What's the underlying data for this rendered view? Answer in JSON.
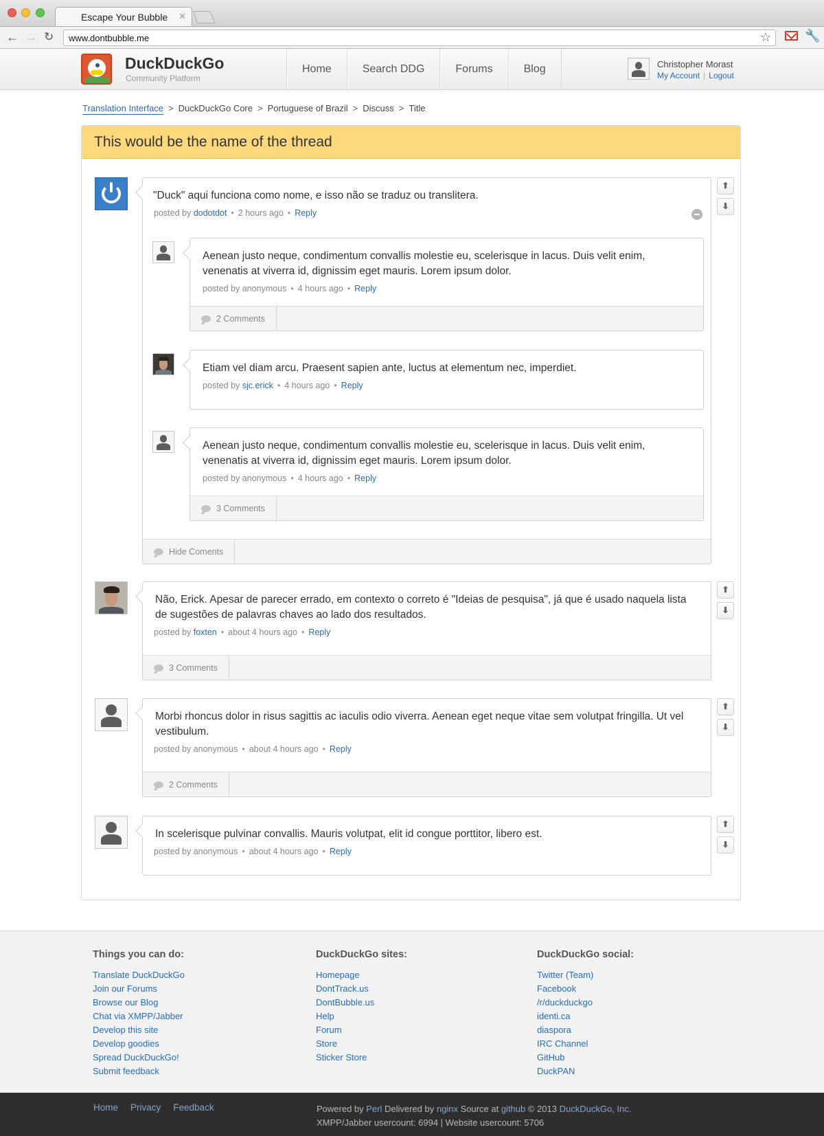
{
  "browser": {
    "tab_title": "Escape Your Bubble",
    "url": "www.dontbubble.me"
  },
  "header": {
    "brand_name": "DuckDuckGo",
    "brand_sub": "Community Platform",
    "nav": [
      "Home",
      "Search DDG",
      "Forums",
      "Blog"
    ],
    "user_name": "Christopher Morast",
    "my_account": "My Account",
    "logout": "Logout"
  },
  "breadcrumb": [
    "Translation Interface",
    "DuckDuckGo Core",
    "Portuguese of Brazil",
    "Discuss",
    "Title"
  ],
  "thread": {
    "title": "This would be the name of the thread",
    "posted_by_label": "posted by",
    "reply_label": "Reply",
    "posts": [
      {
        "text": "\"Duck\" aqui funciona como nome, e isso não se traduz ou translitera.",
        "author": "dodotdot",
        "time": "2 hours ago",
        "comments_label": "Hide Coments"
      },
      {
        "text": "Não, Erick. Apesar de parecer errado, em contexto o correto é \"Ideias de pesquisa\", já que é usado naquela lista de sugestões de palavras chaves ao lado dos resultados.",
        "author": "foxten",
        "time": "about 4 hours ago",
        "comments_label": "3 Comments"
      },
      {
        "text": "Morbi rhoncus dolor in risus sagittis ac iaculis odio viverra. Aenean eget neque vitae sem volutpat fringilla. Ut vel vestibulum.",
        "author": "anonymous",
        "time": "about 4 hours ago",
        "comments_label": "2 Comments"
      },
      {
        "text": "In scelerisque pulvinar convallis. Mauris volutpat, elit id congue porttitor, libero est.",
        "author": "anonymous",
        "time": "about 4 hours ago"
      }
    ],
    "replies": [
      {
        "text": "Aenean justo neque, condimentum convallis molestie eu, scelerisque in lacus. Duis velit enim, venenatis at viverra id, dignissim eget mauris. Lorem ipsum dolor.",
        "author": "anonymous",
        "time": "4 hours ago",
        "comments_label": "2 Comments"
      },
      {
        "text": "Etiam vel diam arcu. Praesent sapien ante, luctus at elementum nec, imperdiet.",
        "author": "sjc.erick",
        "time": "4 hours ago"
      },
      {
        "text": "Aenean justo neque, condimentum convallis molestie eu, scelerisque in lacus. Duis velit enim, venenatis at viverra id, dignissim eget mauris. Lorem ipsum dolor.",
        "author": "anonymous",
        "time": "4 hours ago",
        "comments_label": "3 Comments"
      }
    ]
  },
  "footer": {
    "col1": {
      "heading": "Things you can do:",
      "links": [
        "Translate DuckDuckGo",
        "Join our Forums",
        "Browse our Blog",
        "Chat via XMPP/Jabber",
        "Develop this site",
        "Develop goodies",
        "Spread DuckDuckGo!",
        "Submit feedback"
      ]
    },
    "col2": {
      "heading": "DuckDuckGo sites:",
      "links": [
        "Homepage",
        "DontTrack.us",
        "DontBubble.us",
        "Help",
        "Forum",
        "Store",
        "Sticker Store"
      ]
    },
    "col3": {
      "heading": "DuckDuckGo social:",
      "links": [
        "Twitter (Team)",
        "Facebook",
        "/r/duckduckgo",
        "identi.ca",
        "diaspora",
        "IRC Channel",
        "GitHub",
        "DuckPAN"
      ]
    },
    "bottom_links": [
      "Home",
      "Privacy",
      "Feedback"
    ],
    "powered": {
      "p1": "Powered by ",
      "perl": "Perl",
      "p2": " Delivered by ",
      "nginx": "nginx",
      "p3": " Source at ",
      "github": "github",
      "p4": " © 2013 ",
      "company": "DuckDuckGo, Inc.",
      "stats": "XMPP/Jabber usercount: 6994 | Website usercount: 5706"
    }
  },
  "colors": {
    "link": "#2b6bb5",
    "thread_title_bg": "#fdd97b",
    "footer_bar": "#2e2e2e"
  }
}
